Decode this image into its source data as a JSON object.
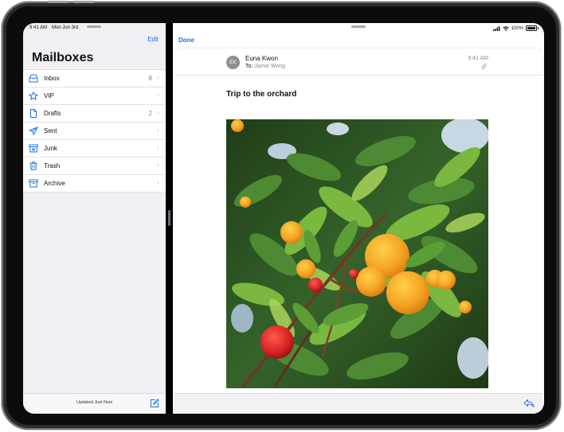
{
  "status_bar": {
    "time": "9:41 AM",
    "date": "Mon Jun 3rd",
    "battery": "100%"
  },
  "sidebar": {
    "edit_label": "Edit",
    "title": "Mailboxes",
    "mailboxes": [
      {
        "label": "Inbox",
        "count": "8",
        "icon": "inbox-icon"
      },
      {
        "label": "VIP",
        "count": "",
        "icon": "star-icon"
      },
      {
        "label": "Drafts",
        "count": "2",
        "icon": "document-icon"
      },
      {
        "label": "Sent",
        "count": "",
        "icon": "paper-plane-icon"
      },
      {
        "label": "Junk",
        "count": "",
        "icon": "junk-bin-icon"
      },
      {
        "label": "Trash",
        "count": "",
        "icon": "trash-icon"
      },
      {
        "label": "Archive",
        "count": "",
        "icon": "archive-box-icon"
      }
    ],
    "status_text": "Updated Just Now"
  },
  "message": {
    "done_label": "Done",
    "avatar_initials": "EK",
    "sender": "Euna Kwon",
    "to_prefix": "To:",
    "recipient": "Jamie Wong",
    "time": "9:41 AM",
    "subject": "Trip to the orchard"
  },
  "colors": {
    "accent": "#1a73e8",
    "avatar": "#8e8e93"
  }
}
